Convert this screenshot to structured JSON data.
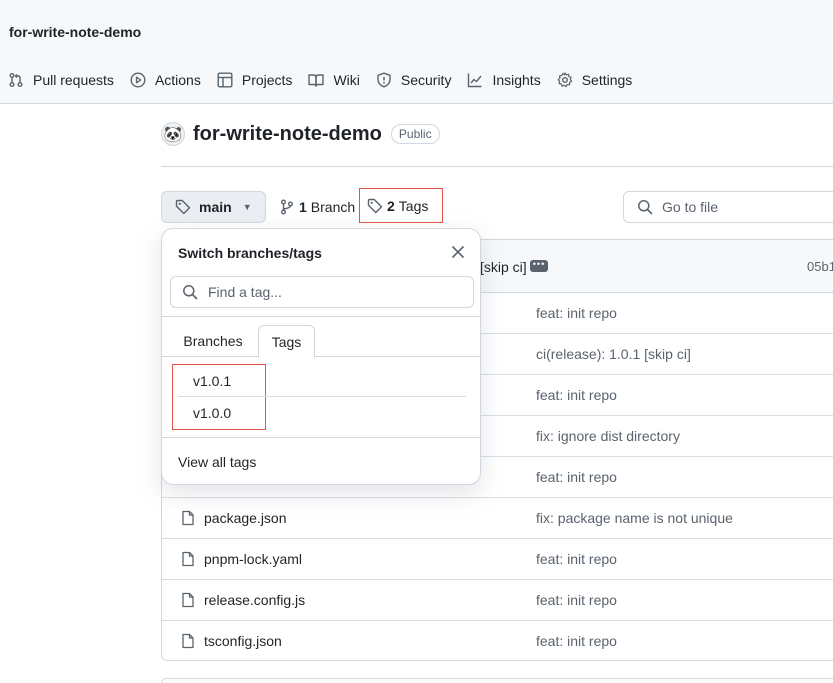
{
  "header": {
    "repo_breadcrumb": "for-write-note-demo",
    "nav": [
      {
        "label": "Pull requests",
        "icon": "pull-request-icon"
      },
      {
        "label": "Actions",
        "icon": "play-icon"
      },
      {
        "label": "Projects",
        "icon": "table-icon"
      },
      {
        "label": "Wiki",
        "icon": "book-icon"
      },
      {
        "label": "Security",
        "icon": "shield-icon"
      },
      {
        "label": "Insights",
        "icon": "graph-icon"
      },
      {
        "label": "Settings",
        "icon": "gear-icon"
      }
    ]
  },
  "repo": {
    "avatar_icon": "panda-avatar",
    "name": "for-write-note-demo",
    "visibility": "Public"
  },
  "toolbar": {
    "branch": "main",
    "branch_count": "1",
    "branch_label": "Branch",
    "tag_count": "2",
    "tag_label": "Tags",
    "goto_placeholder": "Go to file"
  },
  "file_list": {
    "head_message": "[skip ci]",
    "head_sha": "05b1",
    "rows": [
      {
        "name": "",
        "message": "feat: init repo"
      },
      {
        "name": "",
        "message": "ci(release): 1.0.1 [skip ci]"
      },
      {
        "name": "",
        "message": "feat: init repo"
      },
      {
        "name": "",
        "message": "fix: ignore dist directory"
      },
      {
        "name": "",
        "message": "feat: init repo"
      },
      {
        "name": "package.json",
        "message": "fix: package name is not unique"
      },
      {
        "name": "pnpm-lock.yaml",
        "message": "feat: init repo"
      },
      {
        "name": "release.config.js",
        "message": "feat: init repo"
      },
      {
        "name": "tsconfig.json",
        "message": "feat: init repo"
      }
    ]
  },
  "dropdown": {
    "title": "Switch branches/tags",
    "search_placeholder": "Find a tag...",
    "tabs": [
      "Branches",
      "Tags"
    ],
    "active_tab": "Tags",
    "tags": [
      "v1.0.1",
      "v1.0.0"
    ],
    "view_all": "View all tags"
  },
  "colors": {
    "highlight": "#e5534b",
    "border": "#d0d7de",
    "muted_text": "#59636e"
  }
}
